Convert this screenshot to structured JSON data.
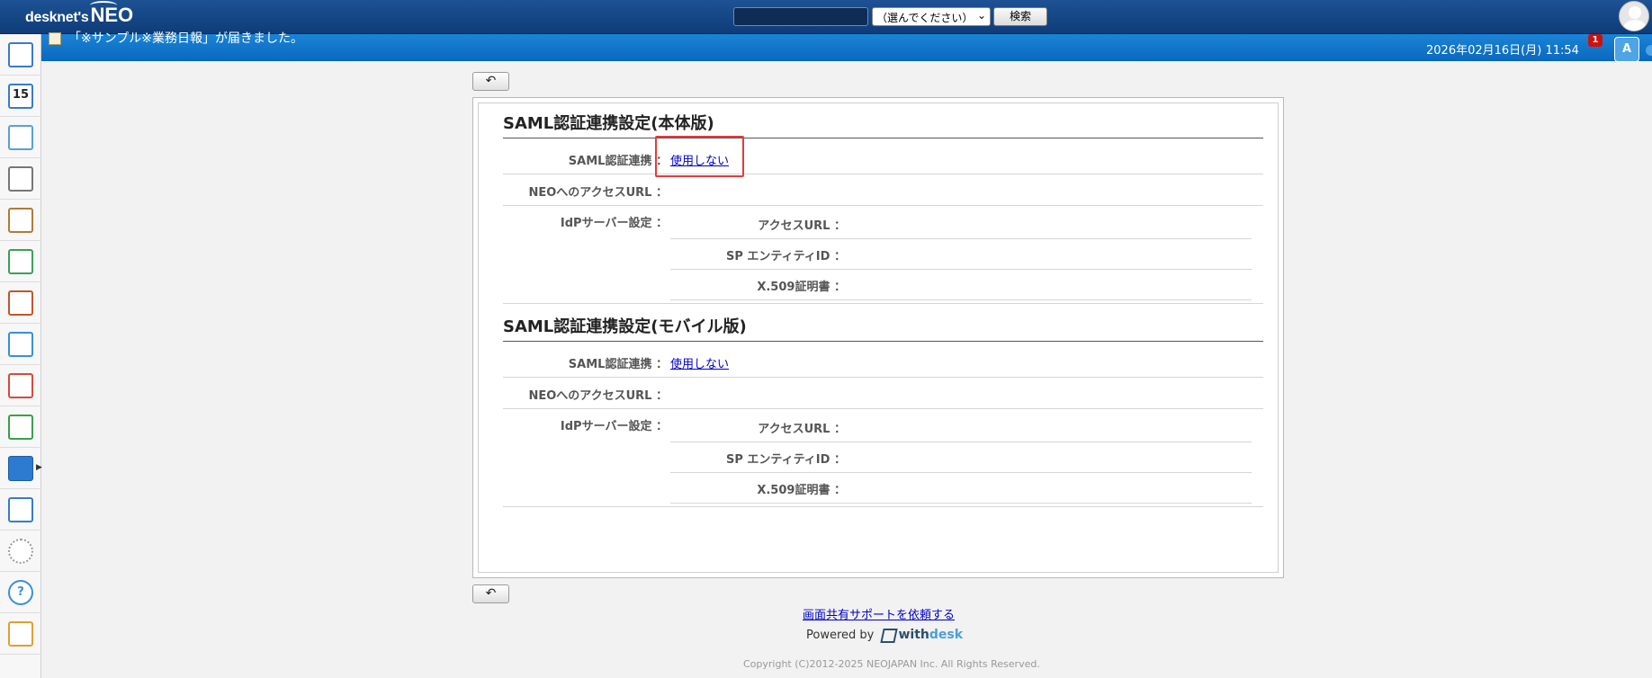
{
  "header": {
    "logo_small": "desknet's",
    "logo_big": "NEO",
    "search_value": "",
    "select_value": "（選んでください）",
    "search_button": "検索"
  },
  "subbar": {
    "notice": "「※サンプル※業務日報」が届きました。",
    "datetime": "2026年02月16日(月) 11:54",
    "badge_count": "1"
  },
  "sidebar": {
    "items": [
      {
        "icon": "portal-icon",
        "color": "#3a7bc8"
      },
      {
        "icon": "calendar-icon",
        "color": "#3a7bc8",
        "text": "15"
      },
      {
        "icon": "facility-icon",
        "color": "#5aa0d8"
      },
      {
        "icon": "bulletin-icon",
        "color": "#777777"
      },
      {
        "icon": "todo-icon",
        "color": "#b07a3a"
      },
      {
        "icon": "workflow-icon",
        "color": "#3aa05a"
      },
      {
        "icon": "cabinet-icon",
        "color": "#c0572a"
      },
      {
        "icon": "mail-icon",
        "color": "#3a8fd8"
      },
      {
        "icon": "apps-icon",
        "color": "#d84a3a"
      },
      {
        "icon": "rabbit-icon",
        "color": "#3aa04a"
      },
      {
        "icon": "neo-settings-icon",
        "color": "#2c7bd1"
      },
      {
        "icon": "list-settings-icon",
        "color": "#3a7bc8"
      },
      {
        "icon": "gear-icon",
        "color": "#999999"
      },
      {
        "icon": "help-icon",
        "color": "#3a8fd8"
      },
      {
        "icon": "support-icon",
        "color": "#e0a030"
      }
    ]
  },
  "main": {
    "back_button": "↶",
    "sections": [
      {
        "title": "SAML認証連携設定(本体版)",
        "saml_label": "SAML認証連携",
        "saml_value": "使用しない",
        "url_label": "NEOへのアクセスURL",
        "idp_label": "IdPサーバー設定",
        "access_url_label": "アクセスURL",
        "sp_label": "SP エンティティID",
        "cert_label": "X.509証明書"
      },
      {
        "title": "SAML認証連携設定(モバイル版)",
        "saml_label": "SAML認証連携",
        "saml_value": "使用しない",
        "url_label": "NEOへのアクセスURL",
        "idp_label": "IdPサーバー設定",
        "access_url_label": "アクセスURL",
        "sp_label": "SP エンティティID",
        "cert_label": "X.509証明書"
      }
    ],
    "colon": "："
  },
  "footer": {
    "support_link": "画面共有サポートを依頼する",
    "powered_by": "Powered by",
    "brand_with": "with",
    "brand_desk": "desk",
    "copyright": "Copyright (C)2012-2025 NEOJAPAN Inc. All Rights Reserved."
  }
}
